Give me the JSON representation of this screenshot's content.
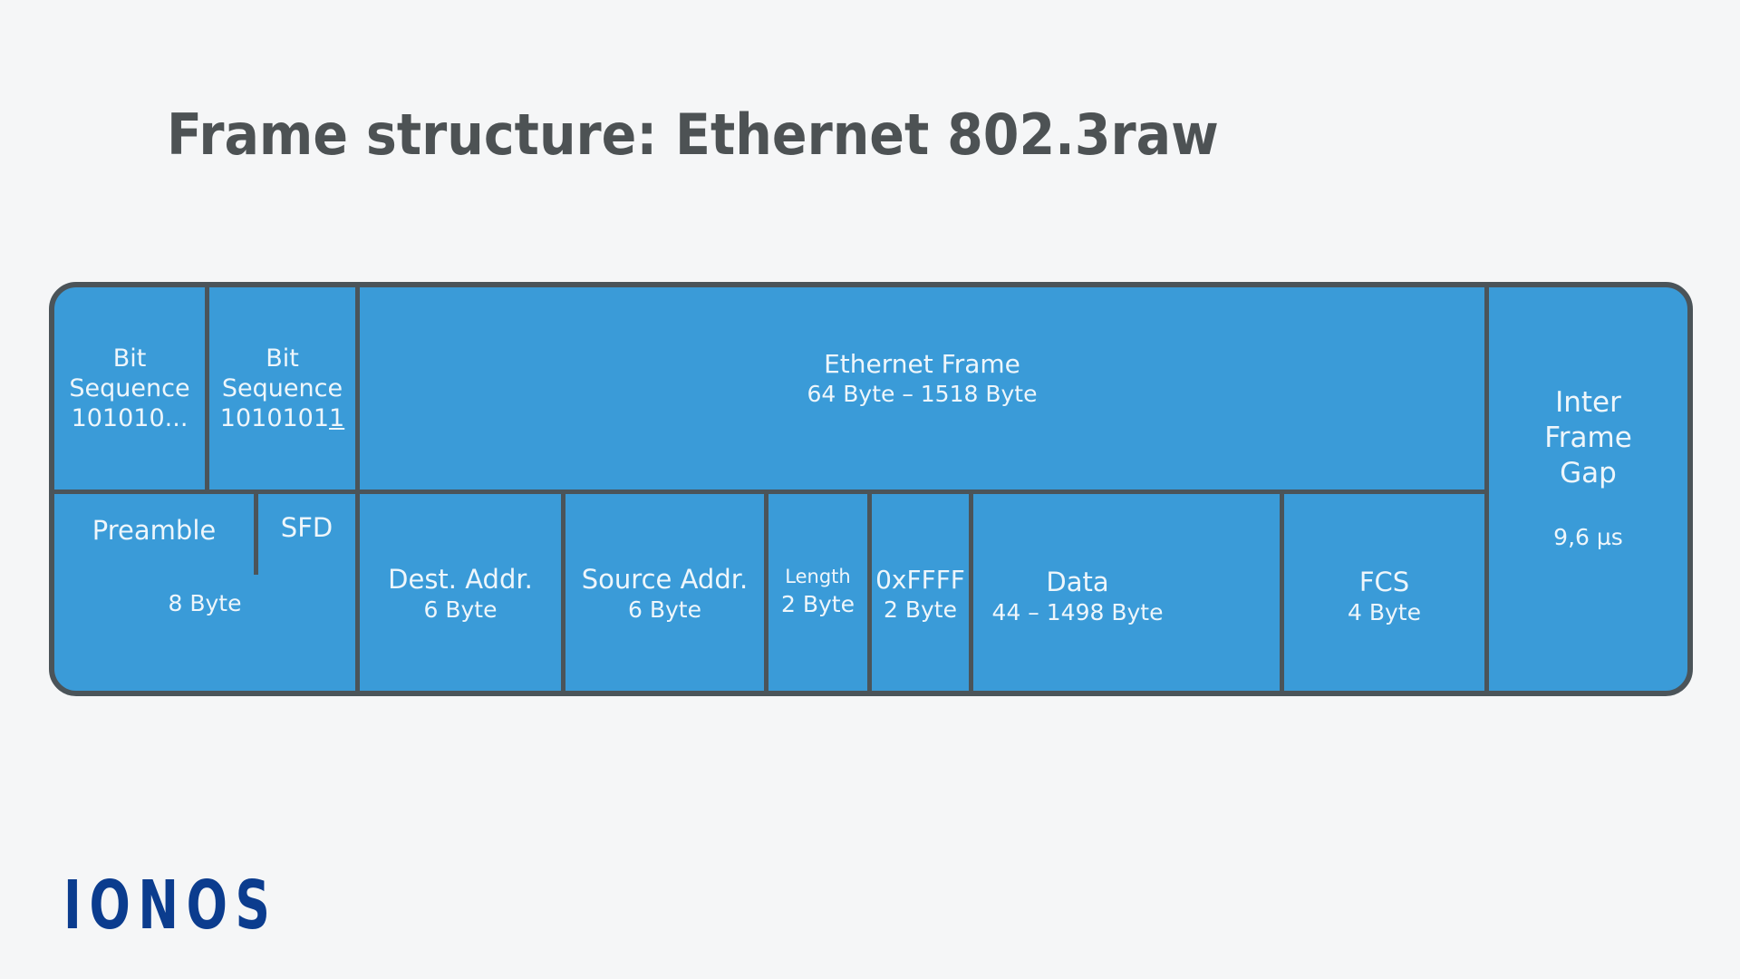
{
  "title": "Frame structure: Ethernet 802.3raw",
  "logo": "IONOS",
  "colors": {
    "background": "#f5f6f7",
    "field_fill": "#3a9bd8",
    "border": "#4b5459",
    "title_text": "#4d5254",
    "field_text": "#eef6fb",
    "logo": "#0b3c8e"
  },
  "top_row": {
    "bit_sequence_1": {
      "label": "Bit",
      "label2": "Sequence",
      "value": "101010..."
    },
    "bit_sequence_2": {
      "label": "Bit",
      "label2": "Sequence",
      "value_prefix": "1010101",
      "value_underlined": "1"
    },
    "ethernet_frame": {
      "label": "Ethernet Frame",
      "size": "64 Byte – 1518 Byte"
    }
  },
  "bottom_row": {
    "preamble": {
      "label": "Preamble"
    },
    "sfd": {
      "label": "SFD"
    },
    "preamble_sfd_size": "8 Byte",
    "fields": [
      {
        "label": "Dest. Addr.",
        "size": "6 Byte"
      },
      {
        "label": "Source Addr.",
        "size": "6 Byte"
      },
      {
        "label": "Length",
        "size": "2 Byte"
      },
      {
        "label": "0xFFFF",
        "size": "2 Byte"
      },
      {
        "label": "Data",
        "size": "44 – 1498 Byte"
      },
      {
        "label": "FCS",
        "size": "4 Byte"
      }
    ]
  },
  "inter_frame_gap": {
    "line1": "Inter",
    "line2": "Frame",
    "line3": "Gap",
    "duration": "9,6 µs"
  }
}
